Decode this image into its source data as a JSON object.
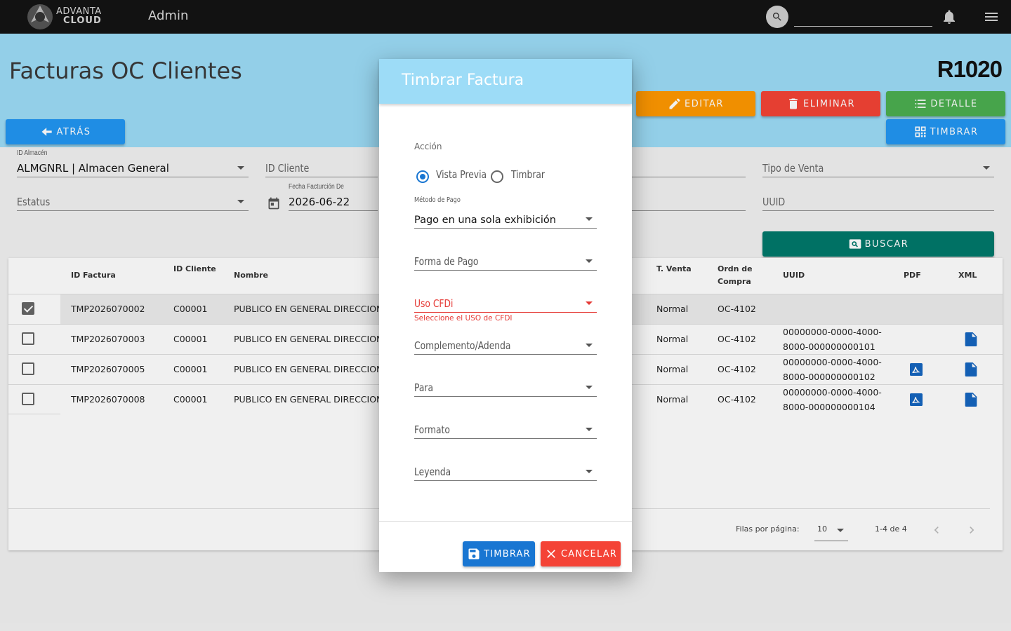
{
  "topbar": {
    "logo_line1": "ADVANTA",
    "logo_line2": "CLOUD",
    "section": "Admin"
  },
  "header": {
    "title": "Facturas OC Clientes",
    "code": "R1020",
    "buttons": {
      "atras": "ATRÁS",
      "editar": "EDITAR",
      "eliminar": "ELIMINAR",
      "detalle": "DETALLE",
      "timbrar": "TIMBRAR"
    }
  },
  "filters": {
    "almacen_label": "ID Almacén",
    "almacen_value": "ALMGNRL | Almacen General",
    "cliente_placeholder": "ID Cliente",
    "tipo_venta_placeholder": "Tipo de Venta",
    "estatus_placeholder": "Estatus",
    "fecha_label": "Fecha Facturción De",
    "fecha_value": "2026-06-22",
    "uuid_placeholder": "UUID",
    "buscar_label": "BUSCAR"
  },
  "table": {
    "headers": {
      "id_factura": "ID Factura",
      "id_cliente": "ID Cliente",
      "nombre": "Nombre",
      "t_venta": "T. Venta",
      "orden_l1": "Ordn de",
      "orden_l2": "Compra",
      "uuid": "UUID",
      "pdf": "PDF",
      "xml": "XML"
    },
    "rows": [
      {
        "id": "TMP2026070002",
        "cliente": "C00001",
        "nombre": "PUBLICO EN GENERAL DIRECCION",
        "venta": "Normal",
        "orden": "OC-4102",
        "uuid_l1": "",
        "uuid_l2": "",
        "checked": true,
        "pdf": false,
        "xml": false
      },
      {
        "id": "TMP2026070003",
        "cliente": "C00001",
        "nombre": "PUBLICO EN GENERAL DIRECCION",
        "venta": "Normal",
        "orden": "OC-4102",
        "uuid_l1": "00000000-0000-4000-",
        "uuid_l2": "8000-000000000101",
        "checked": false,
        "pdf": false,
        "xml": true
      },
      {
        "id": "TMP2026070005",
        "cliente": "C00001",
        "nombre": "PUBLICO EN GENERAL DIRECCION",
        "venta": "Normal",
        "orden": "OC-4102",
        "uuid_l1": "00000000-0000-4000-",
        "uuid_l2": "8000-000000000102",
        "checked": false,
        "pdf": true,
        "xml": true
      },
      {
        "id": "TMP2026070008",
        "cliente": "C00001",
        "nombre": "PUBLICO EN GENERAL DIRECCION",
        "venta": "Normal",
        "orden": "OC-4102",
        "uuid_l1": "00000000-0000-4000-",
        "uuid_l2": "8000-000000000104",
        "checked": false,
        "pdf": true,
        "xml": true
      }
    ],
    "footer": {
      "rows_per_page_label": "Filas por página:",
      "rows_per_page_value": "10",
      "range": "1-4 de 4"
    }
  },
  "dialog": {
    "title": "Timbrar Factura",
    "accion_label": "Acción",
    "radio_preview": "Vista Previa",
    "radio_timbrar": "Timbrar",
    "selected_action": "Vista Previa",
    "metodo_pago_label": "Método de Pago",
    "metodo_pago_value": "Pago en una sola exhibición",
    "forma_pago": "Forma de Pago",
    "uso_cfdi": "Uso CFDi",
    "uso_cfdi_error": "Seleccione el USO de CFDI",
    "complemento": "Complemento/Adenda",
    "para": "Para",
    "formato": "Formato",
    "leyenda": "Leyenda",
    "btn_timbrar": "TIMBRAR",
    "btn_cancelar": "CANCELAR"
  },
  "colors": {
    "band": "#9ddcf7",
    "primary": "#2196f3",
    "warning": "#ff9800",
    "danger": "#f44336",
    "success": "#4caf50",
    "teal": "#00796b",
    "error": "#e53935"
  }
}
